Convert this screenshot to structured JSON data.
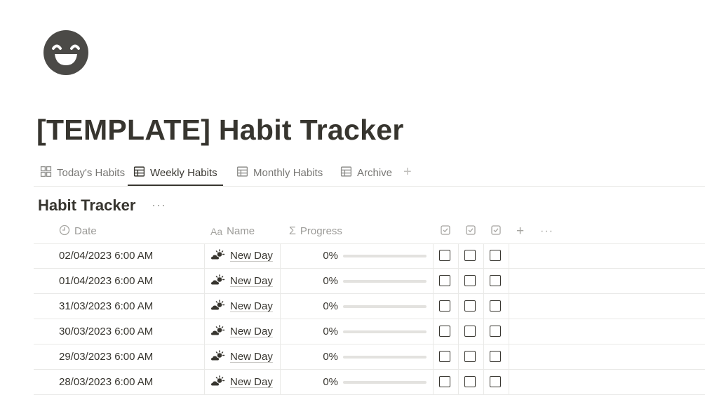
{
  "page": {
    "icon": "grinning-face-icon",
    "title": "[TEMPLATE] Habit Tracker"
  },
  "tabs": [
    {
      "label": "Today's Habits",
      "icon": "gallery-icon",
      "active": false
    },
    {
      "label": "Weekly Habits",
      "icon": "table-icon",
      "active": true
    },
    {
      "label": "Monthly Habits",
      "icon": "table-icon",
      "active": false
    },
    {
      "label": "Archive",
      "icon": "table-icon",
      "active": false
    }
  ],
  "database": {
    "title": "Habit Tracker",
    "more": "···",
    "columns": {
      "date": "Date",
      "name_prefix": "Aa",
      "name": "Name",
      "progress_prefix": "Σ",
      "progress": "Progress",
      "add": "+",
      "more": "···"
    },
    "rows": [
      {
        "date": "02/04/2023 6:00 AM",
        "name": "New Day",
        "progress": "0%",
        "progress_value": 0,
        "checks": [
          false,
          false,
          false
        ]
      },
      {
        "date": "01/04/2023 6:00 AM",
        "name": "New Day",
        "progress": "0%",
        "progress_value": 0,
        "checks": [
          false,
          false,
          false
        ]
      },
      {
        "date": "31/03/2023 6:00 AM",
        "name": "New Day",
        "progress": "0%",
        "progress_value": 0,
        "checks": [
          false,
          false,
          false
        ]
      },
      {
        "date": "30/03/2023 6:00 AM",
        "name": "New Day",
        "progress": "0%",
        "progress_value": 0,
        "checks": [
          false,
          false,
          false
        ]
      },
      {
        "date": "29/03/2023 6:00 AM",
        "name": "New Day",
        "progress": "0%",
        "progress_value": 0,
        "checks": [
          false,
          false,
          false
        ]
      },
      {
        "date": "28/03/2023 6:00 AM",
        "name": "New Day",
        "progress": "0%",
        "progress_value": 0,
        "checks": [
          false,
          false,
          false
        ]
      }
    ]
  }
}
